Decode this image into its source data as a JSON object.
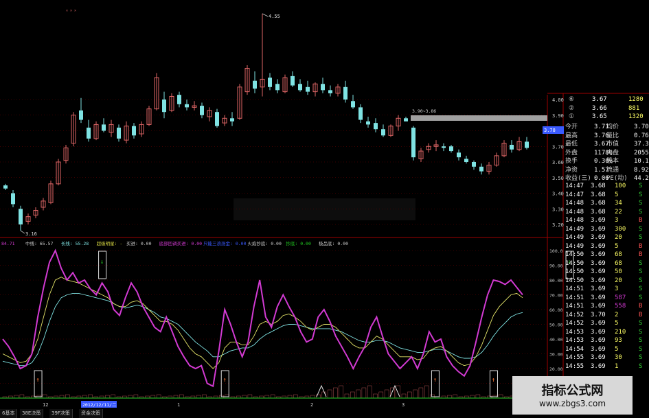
{
  "colors": {
    "up": "#e06666",
    "down": "#7fe3e3",
    "pink": "#d23ad2",
    "yellow": "#e6e66a",
    "grid": "#7a0000",
    "axis": "#a00000",
    "gray": "#a0a0a0"
  },
  "candles": [
    {
      "o": 3.45,
      "h": 3.46,
      "l": 3.42,
      "c": 3.43
    },
    {
      "o": 3.4,
      "h": 3.42,
      "l": 3.31,
      "c": 3.33
    },
    {
      "o": 3.3,
      "h": 3.32,
      "l": 3.16,
      "c": 3.2
    },
    {
      "o": 3.22,
      "h": 3.27,
      "l": 3.2,
      "c": 3.25
    },
    {
      "o": 3.26,
      "h": 3.31,
      "l": 3.24,
      "c": 3.29
    },
    {
      "o": 3.31,
      "h": 3.37,
      "l": 3.29,
      "c": 3.35
    },
    {
      "o": 3.34,
      "h": 3.48,
      "l": 3.33,
      "c": 3.46
    },
    {
      "o": 3.46,
      "h": 3.62,
      "l": 3.45,
      "c": 3.6
    },
    {
      "o": 3.61,
      "h": 3.71,
      "l": 3.59,
      "c": 3.69
    },
    {
      "o": 3.72,
      "h": 3.92,
      "l": 3.7,
      "c": 3.9
    },
    {
      "o": 3.93,
      "h": 4.01,
      "l": 3.85,
      "c": 3.87
    },
    {
      "o": 3.82,
      "h": 3.87,
      "l": 3.73,
      "c": 3.75
    },
    {
      "o": 3.75,
      "h": 3.86,
      "l": 3.74,
      "c": 3.84
    },
    {
      "o": 3.84,
      "h": 3.88,
      "l": 3.79,
      "c": 3.8
    },
    {
      "o": 3.79,
      "h": 3.87,
      "l": 3.76,
      "c": 3.84
    },
    {
      "o": 3.82,
      "h": 3.84,
      "l": 3.73,
      "c": 3.75
    },
    {
      "o": 3.74,
      "h": 3.86,
      "l": 3.72,
      "c": 3.83
    },
    {
      "o": 3.83,
      "h": 3.85,
      "l": 3.75,
      "c": 3.77
    },
    {
      "o": 3.78,
      "h": 3.86,
      "l": 3.76,
      "c": 3.84
    },
    {
      "o": 3.84,
      "h": 3.96,
      "l": 3.83,
      "c": 3.94
    },
    {
      "o": 3.94,
      "h": 4.17,
      "l": 3.93,
      "c": 4.14
    },
    {
      "o": 4.0,
      "h": 4.05,
      "l": 3.88,
      "c": 3.92
    },
    {
      "o": 3.93,
      "h": 4.04,
      "l": 3.92,
      "c": 4.02
    },
    {
      "o": 4.03,
      "h": 4.05,
      "l": 3.95,
      "c": 3.97
    },
    {
      "o": 3.97,
      "h": 4.0,
      "l": 3.93,
      "c": 3.95
    },
    {
      "o": 3.95,
      "h": 3.99,
      "l": 3.93,
      "c": 3.96
    },
    {
      "o": 3.96,
      "h": 3.98,
      "l": 3.88,
      "c": 3.9
    },
    {
      "o": 3.89,
      "h": 3.95,
      "l": 3.86,
      "c": 3.93
    },
    {
      "o": 3.92,
      "h": 3.94,
      "l": 3.82,
      "c": 3.83
    },
    {
      "o": 3.85,
      "h": 3.9,
      "l": 3.83,
      "c": 3.88
    },
    {
      "o": 3.88,
      "h": 3.92,
      "l": 3.83,
      "c": 3.86
    },
    {
      "o": 3.88,
      "h": 4.1,
      "l": 3.87,
      "c": 4.08
    },
    {
      "o": 4.05,
      "h": 4.22,
      "l": 4.03,
      "c": 4.2
    },
    {
      "o": 4.12,
      "h": 4.18,
      "l": 4.04,
      "c": 4.07
    },
    {
      "o": 4.08,
      "h": 4.55,
      "l": 4.02,
      "c": 4.13
    },
    {
      "o": 4.14,
      "h": 4.17,
      "l": 4.06,
      "c": 4.08
    },
    {
      "o": 4.1,
      "h": 4.13,
      "l": 4.04,
      "c": 4.06
    },
    {
      "o": 4.05,
      "h": 4.16,
      "l": 4.04,
      "c": 4.14
    },
    {
      "o": 4.15,
      "h": 4.18,
      "l": 4.08,
      "c": 4.09
    },
    {
      "o": 4.1,
      "h": 4.13,
      "l": 4.05,
      "c": 4.06
    },
    {
      "o": 4.08,
      "h": 4.12,
      "l": 4.03,
      "c": 4.05
    },
    {
      "o": 4.05,
      "h": 4.11,
      "l": 4.02,
      "c": 4.1
    },
    {
      "o": 4.1,
      "h": 4.14,
      "l": 4.04,
      "c": 4.06
    },
    {
      "o": 4.06,
      "h": 4.09,
      "l": 4.02,
      "c": 4.04
    },
    {
      "o": 4.04,
      "h": 4.1,
      "l": 4.02,
      "c": 4.08
    },
    {
      "o": 4.08,
      "h": 4.12,
      "l": 3.98,
      "c": 4.0
    },
    {
      "o": 3.99,
      "h": 4.03,
      "l": 3.94,
      "c": 3.95
    },
    {
      "o": 3.95,
      "h": 3.97,
      "l": 3.85,
      "c": 3.87
    },
    {
      "o": 3.86,
      "h": 3.89,
      "l": 3.82,
      "c": 3.84
    },
    {
      "o": 3.85,
      "h": 3.88,
      "l": 3.79,
      "c": 3.81
    },
    {
      "o": 3.81,
      "h": 3.84,
      "l": 3.76,
      "c": 3.77
    },
    {
      "o": 3.77,
      "h": 3.84,
      "l": 3.76,
      "c": 3.83
    },
    {
      "o": 3.83,
      "h": 3.9,
      "l": 3.8,
      "c": 3.88
    },
    {
      "o": 3.88,
      "h": 3.89,
      "l": 3.86,
      "c": 3.86
    },
    {
      "o": 3.82,
      "h": 3.83,
      "l": 3.61,
      "c": 3.63
    },
    {
      "o": 3.62,
      "h": 3.69,
      "l": 3.6,
      "c": 3.67
    },
    {
      "o": 3.68,
      "h": 3.72,
      "l": 3.66,
      "c": 3.7
    },
    {
      "o": 3.7,
      "h": 3.74,
      "l": 3.67,
      "c": 3.71
    },
    {
      "o": 3.7,
      "h": 3.72,
      "l": 3.67,
      "c": 3.69
    },
    {
      "o": 3.7,
      "h": 3.71,
      "l": 3.66,
      "c": 3.67
    },
    {
      "o": 3.66,
      "h": 3.68,
      "l": 3.61,
      "c": 3.63
    },
    {
      "o": 3.62,
      "h": 3.64,
      "l": 3.59,
      "c": 3.6
    },
    {
      "o": 3.6,
      "h": 3.61,
      "l": 3.55,
      "c": 3.57
    },
    {
      "o": 3.57,
      "h": 3.59,
      "l": 3.52,
      "c": 3.54
    },
    {
      "o": 3.54,
      "h": 3.6,
      "l": 3.52,
      "c": 3.58
    },
    {
      "o": 3.58,
      "h": 3.66,
      "l": 3.57,
      "c": 3.64
    },
    {
      "o": 3.64,
      "h": 3.74,
      "l": 3.63,
      "c": 3.72
    },
    {
      "o": 3.71,
      "h": 3.74,
      "l": 3.66,
      "c": 3.68
    },
    {
      "o": 3.68,
      "h": 3.76,
      "l": 3.67,
      "c": 3.73
    },
    {
      "o": 3.73,
      "h": 3.76,
      "l": 3.68,
      "c": 3.69
    }
  ],
  "price_axis": {
    "ticks": [
      "4.00",
      "3.90",
      "3.80",
      "3.70",
      "3.60",
      "3.50",
      "3.40",
      "3.30",
      "3.20"
    ],
    "current": "3.78"
  },
  "annotations": {
    "high": "4.55",
    "low": "3.16",
    "gap": "3.90~3.86"
  },
  "indicator_header": [
    {
      "text": "84.71",
      "color": "#d23ad2"
    },
    {
      "text": "中线: 65.57",
      "color": "#cccccc"
    },
    {
      "text": "长线: 55.28",
      "color": "#7fe3e3"
    },
    {
      "text": "超级明星: -",
      "color": "#dddd44"
    },
    {
      "text": "买进: 0.00",
      "color": "#cccccc"
    },
    {
      "text": "底部回调买进: 0.00",
      "color": "#d23ad2"
    },
    {
      "text": "只能三浪涨金: 0.00",
      "color": "#3a5aff"
    },
    {
      "text": "火焰抄底: 0.00",
      "color": "#cccccc"
    },
    {
      "text": "抄底: 0.00",
      "color": "#22cc22"
    },
    {
      "text": "极品底: 0.00",
      "color": "#cccccc"
    }
  ],
  "indicator_axis": [
    "100.0",
    "90.00",
    "80.00",
    "70.00",
    "60.00",
    "50.00",
    "40.00",
    "30.00",
    "20.00",
    "10.00"
  ],
  "indicator_series": {
    "short": [
      40,
      35,
      28,
      20,
      22,
      30,
      55,
      75,
      92,
      100,
      88,
      80,
      85,
      78,
      80,
      74,
      70,
      78,
      72,
      60,
      56,
      68,
      78,
      72,
      62,
      55,
      48,
      45,
      55,
      45,
      35,
      28,
      22,
      20,
      22,
      10,
      8,
      32,
      60,
      50,
      38,
      28,
      38,
      62,
      80,
      55,
      48,
      62,
      70,
      62,
      55,
      45,
      38,
      40,
      55,
      60,
      52,
      42,
      35,
      28,
      20,
      28,
      35,
      48,
      55,
      42,
      30,
      25,
      20,
      24,
      28,
      20,
      30,
      45,
      38,
      40,
      28,
      22,
      18,
      15,
      22,
      38,
      55,
      70,
      80,
      79,
      77,
      80,
      75,
      70
    ],
    "mid": [
      30,
      28,
      26,
      24,
      25,
      30,
      40,
      55,
      70,
      80,
      82,
      80,
      79,
      78,
      76,
      74,
      72,
      70,
      68,
      64,
      62,
      62,
      65,
      66,
      64,
      60,
      56,
      52,
      52,
      50,
      46,
      40,
      34,
      30,
      28,
      24,
      20,
      24,
      34,
      38,
      38,
      36,
      36,
      42,
      50,
      52,
      50,
      52,
      56,
      57,
      55,
      52,
      48,
      46,
      48,
      50,
      50,
      48,
      44,
      40,
      36,
      34,
      34,
      38,
      42,
      40,
      36,
      32,
      28,
      28,
      28,
      26,
      27,
      32,
      34,
      35,
      32,
      28,
      24,
      22,
      23,
      28,
      36,
      46,
      56,
      62,
      66,
      70,
      71,
      68
    ],
    "long": [
      25,
      24,
      23,
      22,
      22,
      24,
      30,
      40,
      52,
      62,
      68,
      70,
      71,
      71,
      70,
      69,
      68,
      67,
      66,
      64,
      62,
      61,
      62,
      63,
      62,
      60,
      58,
      55,
      54,
      52,
      50,
      46,
      42,
      38,
      35,
      32,
      28,
      28,
      30,
      32,
      33,
      34,
      34,
      36,
      40,
      43,
      45,
      47,
      49,
      50,
      50,
      49,
      48,
      47,
      47,
      47,
      47,
      46,
      45,
      43,
      41,
      39,
      38,
      38,
      39,
      39,
      38,
      36,
      34,
      33,
      32,
      31,
      31,
      32,
      33,
      33,
      32,
      30,
      28,
      27,
      27,
      28,
      31,
      36,
      42,
      47,
      51,
      55,
      57,
      58
    ]
  },
  "indicator_signals": {
    "buy_boxes": [
      6,
      38,
      74,
      84
    ],
    "sell_boxes": [
      17,
      97
    ]
  },
  "date_axis": {
    "label_12": "12",
    "label_1": "1",
    "label_2": "2",
    "label_3": "3",
    "date": "2012/12/11/二"
  },
  "bottom_tabs": [
    "6基本",
    "38E决策",
    "39F决策",
    "资金决策"
  ],
  "quote_panel": {
    "orders": [
      {
        "idx": "⑥",
        "price": "3.67",
        "vol": "1280"
      },
      {
        "idx": "②",
        "price": "3.66",
        "vol": "881"
      },
      {
        "idx": "①",
        "price": "3.65",
        "vol": "1320"
      }
    ],
    "stats": [
      [
        "今开",
        "3.71",
        "均价",
        "3.70"
      ],
      [
        "最高",
        "3.76",
        "量比",
        "0.76"
      ],
      [
        "最低",
        "3.67",
        "市值",
        "37.3亿"
      ],
      [
        "外盘",
        "11786",
        "内盘",
        "20559"
      ],
      [
        "换手",
        "0.36%",
        "股本",
        "10.1亿"
      ],
      [
        "净资",
        "1.57",
        "流通",
        "8.92亿"
      ],
      [
        "收益(三)",
        "0.06",
        "PE(动)",
        "44.2"
      ]
    ],
    "ticks": [
      [
        "14:47",
        "3.68",
        "100",
        "S"
      ],
      [
        "14:47",
        "3.68",
        "5",
        "S"
      ],
      [
        "14:48",
        "3.68",
        "34",
        "S"
      ],
      [
        "14:48",
        "3.68",
        "22",
        "S"
      ],
      [
        "14:48",
        "3.69",
        "3",
        "B"
      ],
      [
        "14:49",
        "3.69",
        "300",
        "S"
      ],
      [
        "14:49",
        "3.69",
        "20",
        "S"
      ],
      [
        "14:49",
        "3.69",
        "5",
        "B"
      ],
      [
        "14:50",
        "3.69",
        "68",
        "B"
      ],
      [
        "14:50",
        "3.69",
        "68",
        "S"
      ],
      [
        "14:50",
        "3.69",
        "50",
        "S"
      ],
      [
        "14:50",
        "3.69",
        "20",
        "S"
      ],
      [
        "14:51",
        "3.69",
        "3",
        "S"
      ],
      [
        "14:51",
        "3.69",
        "587",
        "S"
      ],
      [
        "14:51",
        "3.69",
        "558",
        "B"
      ],
      [
        "14:52",
        "3.70",
        "2",
        "B"
      ],
      [
        "14:52",
        "3.69",
        "5",
        "S"
      ],
      [
        "14:53",
        "3.69",
        "210",
        "S"
      ],
      [
        "14:53",
        "3.69",
        "93",
        "S"
      ],
      [
        "14:54",
        "3.69",
        "5",
        "S"
      ],
      [
        "14:55",
        "3.69",
        "30",
        "S"
      ],
      [
        "14:55",
        "3.69",
        "1",
        "S"
      ]
    ]
  },
  "logo": {
    "line1": "指标公式网",
    "line2": "www.zbgs3.com"
  }
}
